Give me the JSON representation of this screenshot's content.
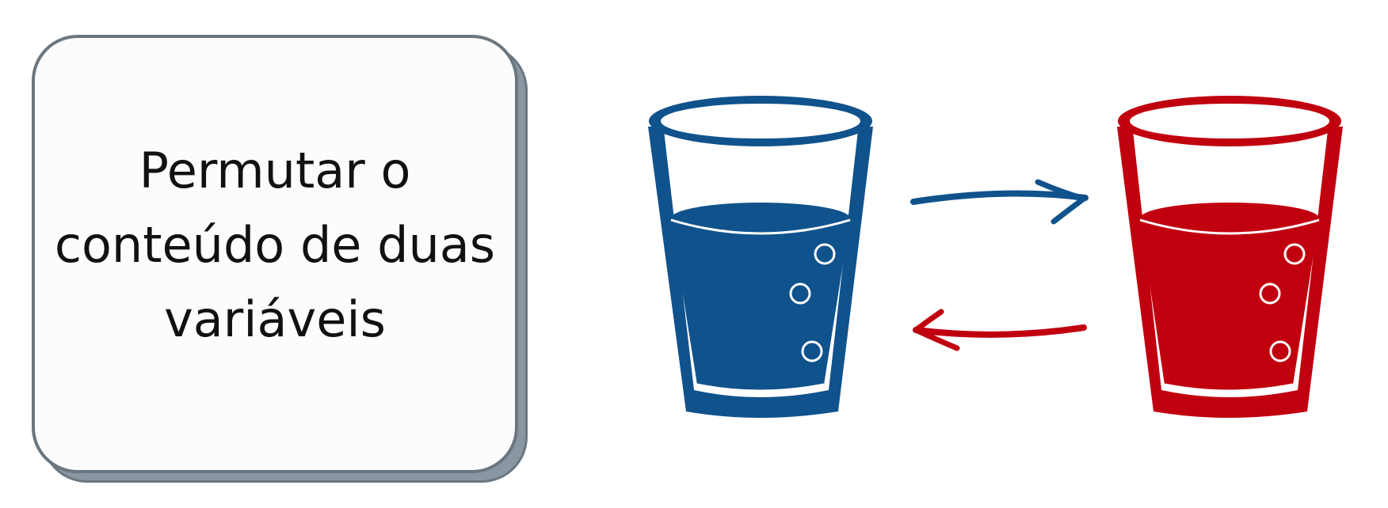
{
  "card": {
    "lines": [
      "Permutar o",
      "conteúdo de duas",
      "variáveis"
    ]
  },
  "colors": {
    "blue": "#10528c",
    "red": "#c0000f",
    "card_border": "#6a7680",
    "card_shadow": "#8a97a3",
    "card_fill": "#fcfcfc"
  },
  "icons": {
    "left_glass": "blue-water-glass-icon",
    "right_glass": "red-water-glass-icon",
    "top_arrow": "arrow-right-icon",
    "bottom_arrow": "arrow-left-icon"
  }
}
